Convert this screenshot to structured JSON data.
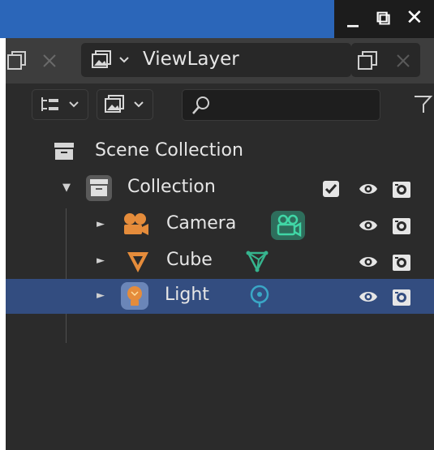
{
  "window": {
    "minimize_glyph": "_",
    "restore_glyph": "⧉",
    "close_glyph": "✕"
  },
  "header": {
    "view_layer_name": "ViewLayer",
    "search_placeholder": ""
  },
  "outliner": {
    "scene_collection_label": "Scene Collection",
    "collection_label": "Collection",
    "items": [
      {
        "label": "Camera",
        "type_icon": "camera-object-icon",
        "data_icon": "camera-data-icon"
      },
      {
        "label": "Cube",
        "type_icon": "mesh-object-icon",
        "data_icon": "mesh-data-icon"
      },
      {
        "label": "Light",
        "type_icon": "light-object-icon",
        "data_icon": "light-data-icon",
        "selected": true
      }
    ]
  },
  "colors": {
    "titlebar_blue": "#2b66b9",
    "selection": "#334d80",
    "object_orange": "#e58c3b",
    "data_green": "#36b48e",
    "light_data_teal": "#3aa7c6"
  }
}
